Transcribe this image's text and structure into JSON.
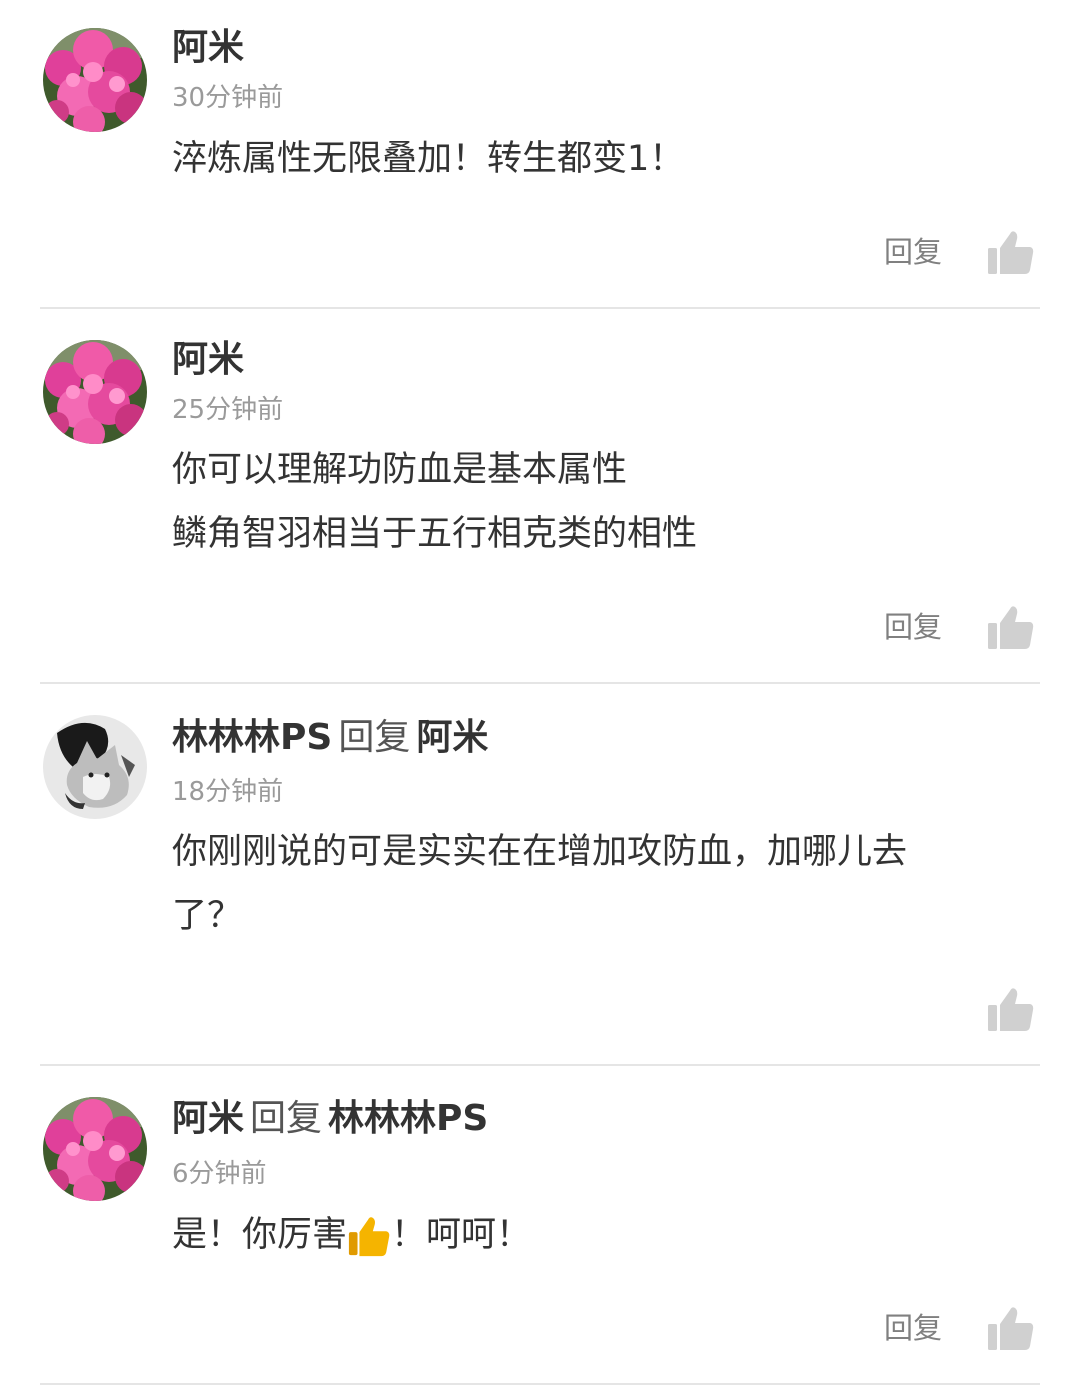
{
  "comments": [
    {
      "author": "阿米",
      "avatar": "pink-flower-avatar",
      "reply_word": "",
      "reply_to": "",
      "time": "30分钟前",
      "lines": [
        "淬炼属性无限叠加！转生都变1！"
      ],
      "reply_label": "回复",
      "like_icon": "thumbs-up-icon"
    },
    {
      "author": "阿米",
      "avatar": "pink-flower-avatar",
      "reply_word": "",
      "reply_to": "",
      "time": "25分钟前",
      "lines": [
        "你可以理解功防血是基本属性",
        "鳞角智羽相当于五行相克类的相性"
      ],
      "reply_label": "回复",
      "like_icon": "thumbs-up-icon"
    },
    {
      "author": "林林林PS",
      "avatar": "wolf-dog-avatar",
      "reply_word": "回复",
      "reply_to": "阿米",
      "time": "18分钟前",
      "lines": [
        "你刚刚说的可是实实在在增加攻防血，加哪儿去",
        "了？"
      ],
      "reply_label": "",
      "like_icon": "thumbs-up-icon"
    },
    {
      "author": "阿米",
      "avatar": "pink-flower-avatar",
      "reply_word": "回复",
      "reply_to": "林林林PS",
      "time": "6分钟前",
      "lines_parts": [
        "是！你厉害",
        "！呵呵！"
      ],
      "emoji": "thumbs-up-emoji",
      "reply_label": "回复",
      "like_icon": "thumbs-up-icon"
    }
  ],
  "colors": {
    "divider": "#e5e5e5",
    "like_icon": "#d0d0d0",
    "emoji": "#f5b400"
  }
}
